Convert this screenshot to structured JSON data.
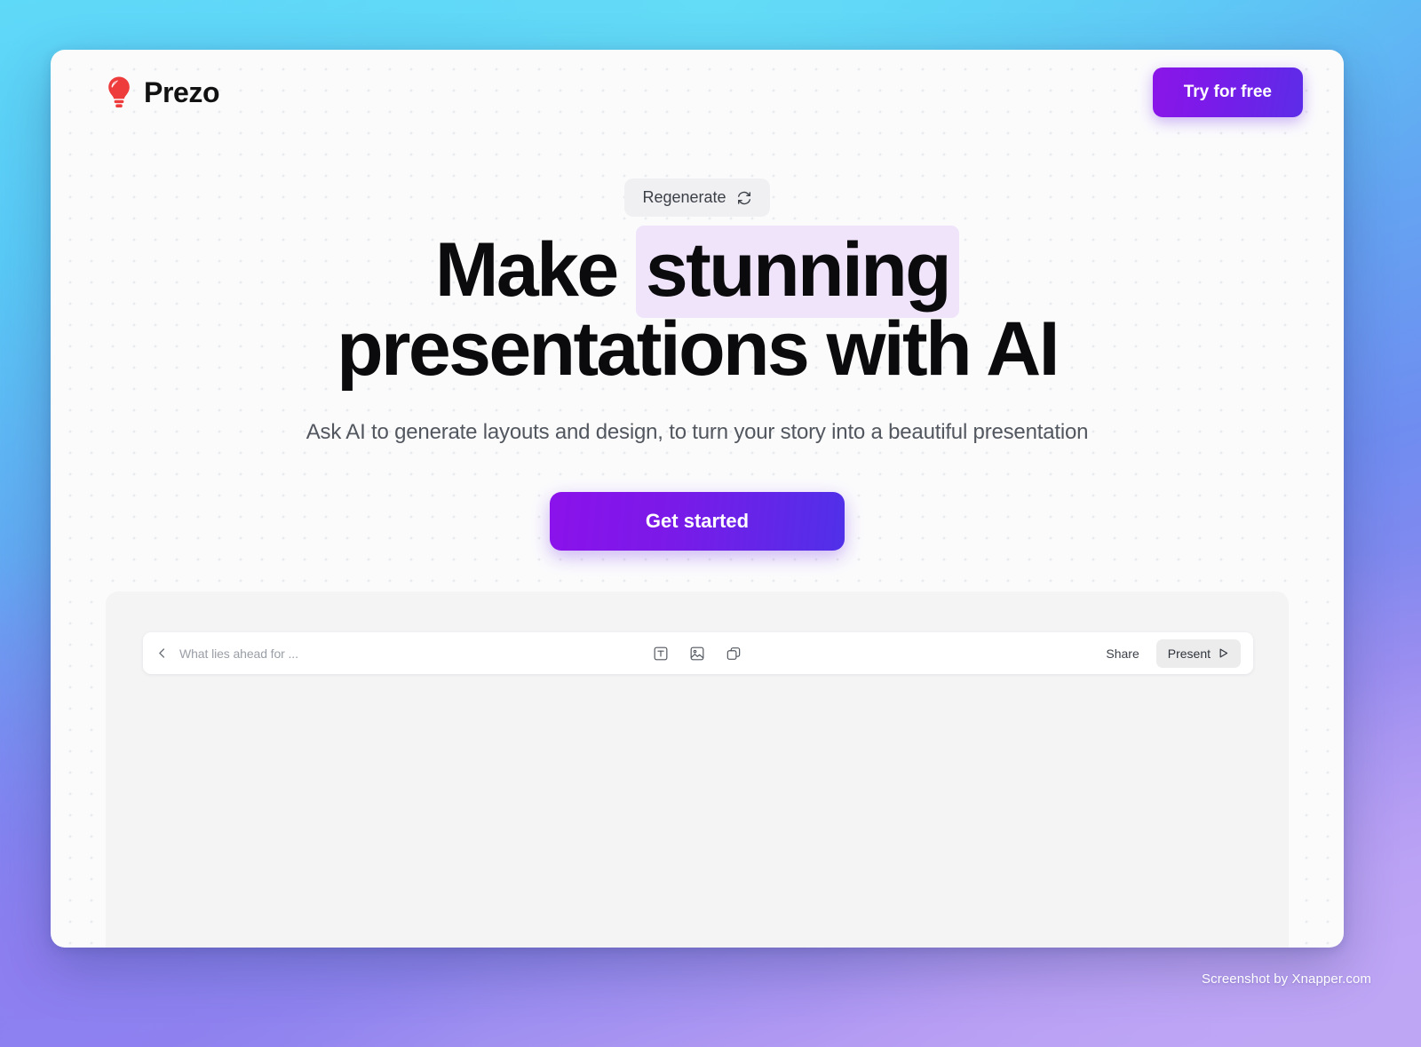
{
  "app": {
    "brand_name": "Prezo",
    "logo_icon": "lightbulb-icon",
    "logo_color": "#ee3b3b"
  },
  "topbar": {
    "try_free_label": "Try for free",
    "try_free_gradient_from": "#8a16e8",
    "try_free_gradient_to": "#5c2ce8"
  },
  "hero": {
    "regenerate_label": "Regenerate",
    "regenerate_icon": "refresh-icon",
    "headline_part_1": "Make",
    "headline_highlight": "stunning",
    "headline_part_2": "presentations with AI",
    "highlight_color": "#f0e4fb",
    "subtitle": "Ask AI to generate layouts and design, to turn your story into a beautiful presentation",
    "cta_label": "Get started",
    "cta_gradient_from": "#8b12ea",
    "cta_gradient_to": "#5030e9"
  },
  "editor": {
    "back_icon": "chevron-left-icon",
    "deck_title": "What lies ahead for ...",
    "tools": [
      {
        "name": "text-box-icon",
        "label": "Text"
      },
      {
        "name": "image-icon",
        "label": "Image"
      },
      {
        "name": "shape-duplicate-icon",
        "label": "Shape"
      }
    ],
    "share_label": "Share",
    "present_label": "Present",
    "present_icon": "play-icon"
  },
  "watermark": {
    "text": "Screenshot by Xnapper.com"
  }
}
